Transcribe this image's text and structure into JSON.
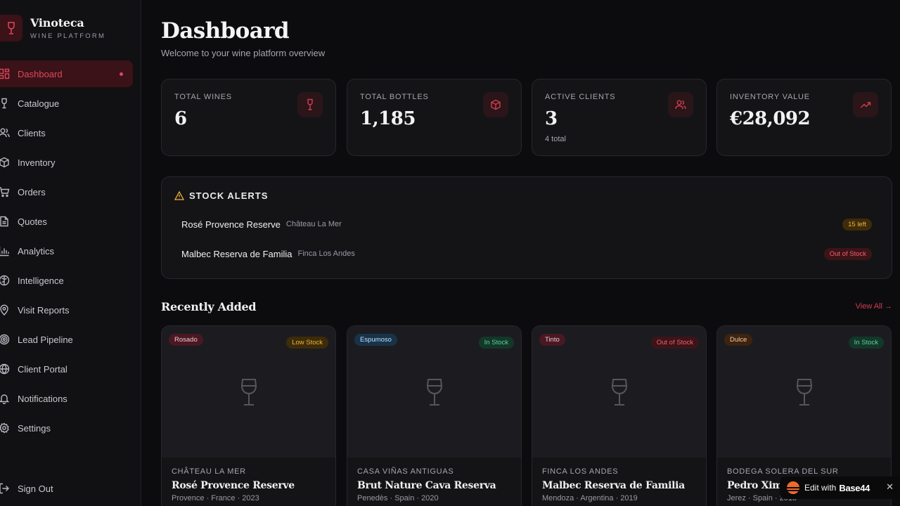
{
  "brand": {
    "name": "Vinoteca",
    "subtitle": "WINE PLATFORM"
  },
  "nav": [
    {
      "label": "Dashboard",
      "icon": "grid-icon",
      "active": true
    },
    {
      "label": "Catalogue",
      "icon": "wine-glass-icon"
    },
    {
      "label": "Clients",
      "icon": "users-icon"
    },
    {
      "label": "Inventory",
      "icon": "box-icon"
    },
    {
      "label": "Orders",
      "icon": "cart-icon"
    },
    {
      "label": "Quotes",
      "icon": "document-icon"
    },
    {
      "label": "Analytics",
      "icon": "bar-chart-icon"
    },
    {
      "label": "Intelligence",
      "icon": "brain-icon"
    },
    {
      "label": "Visit Reports",
      "icon": "map-pin-icon"
    },
    {
      "label": "Lead Pipeline",
      "icon": "target-icon"
    },
    {
      "label": "Client Portal",
      "icon": "globe-icon"
    },
    {
      "label": "Notifications",
      "icon": "bell-icon"
    },
    {
      "label": "Settings",
      "icon": "gear-icon"
    }
  ],
  "signout": {
    "label": "Sign Out"
  },
  "header": {
    "title": "Dashboard",
    "subtitle": "Welcome to your wine platform overview"
  },
  "stats": [
    {
      "label": "TOTAL WINES",
      "value": "6",
      "note": "",
      "icon": "wine-glass-icon"
    },
    {
      "label": "TOTAL BOTTLES",
      "value": "1,185",
      "note": "",
      "icon": "box-icon"
    },
    {
      "label": "ACTIVE CLIENTS",
      "value": "3",
      "note": "4 total",
      "icon": "users-icon"
    },
    {
      "label": "INVENTORY VALUE",
      "value": "€28,092",
      "note": "",
      "icon": "trending-up-icon"
    }
  ],
  "alerts": {
    "title": "STOCK ALERTS",
    "items": [
      {
        "name": "Rosé Provence Reserve",
        "producer": "Château La Mer",
        "status": "15 left"
      },
      {
        "name": "Malbec Reserva de Familia",
        "producer": "Finca Los Andes",
        "status": "Out of Stock"
      }
    ]
  },
  "recent": {
    "title": "Recently Added",
    "view_all": "View All →",
    "cards": [
      {
        "type": "Rosado",
        "stock": "Low Stock",
        "producer": "CHÂTEAU LA MER",
        "name": "Rosé Provence Reserve",
        "meta": "Provence · France · 2023"
      },
      {
        "type": "Espumoso",
        "stock": "In Stock",
        "producer": "CASA VIÑAS ANTIGUAS",
        "name": "Brut Nature Cava Reserva",
        "meta": "Penedès · Spain · 2020"
      },
      {
        "type": "Tinto",
        "stock": "Out of Stock",
        "producer": "FINCA LOS ANDES",
        "name": "Malbec Reserva de Familia",
        "meta": "Mendoza · Argentina · 2019"
      },
      {
        "type": "Dulce",
        "stock": "In Stock",
        "producer": "BODEGA SOLERA DEL SUR",
        "name": "Pedro Ximé",
        "meta": "Jerez · Spain · 2018"
      }
    ]
  },
  "base44": {
    "edit": "Edit with",
    "brand": "Base44",
    "close": "✕"
  },
  "colors": {
    "accent": "#e0465c",
    "background": "#0c0c0e",
    "card": "#141417",
    "warning": "#f0b43a",
    "success": "#5fd39a"
  }
}
